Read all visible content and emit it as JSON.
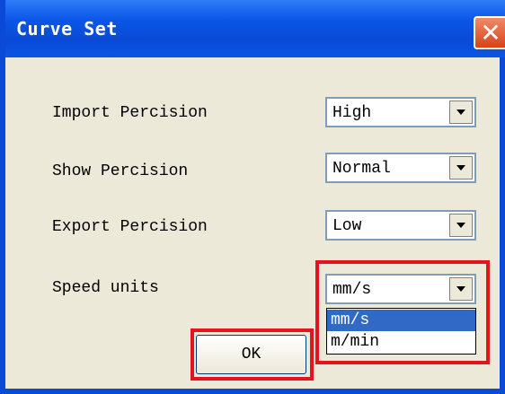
{
  "window": {
    "title": "Curve Set",
    "close_glyph": "✕"
  },
  "fields": [
    {
      "label": "Import Percision",
      "value": "High"
    },
    {
      "label": "Show Percision",
      "value": "Normal"
    },
    {
      "label": "Export Percision",
      "value": "Low"
    },
    {
      "label": "Speed units",
      "value": "mm/s"
    }
  ],
  "speed_units_dropdown": {
    "options": [
      "mm/s",
      "m/min"
    ],
    "highlighted": "mm/s"
  },
  "ok_button": {
    "label": "OK"
  },
  "colors": {
    "title_bar": "#0a4ad6",
    "close_button": "#e0522a",
    "highlight_box": "#e5141c",
    "selected_option": "#316ac5"
  },
  "icons": {
    "close": "close-icon",
    "combo_arrow": "chevron-down-icon"
  }
}
